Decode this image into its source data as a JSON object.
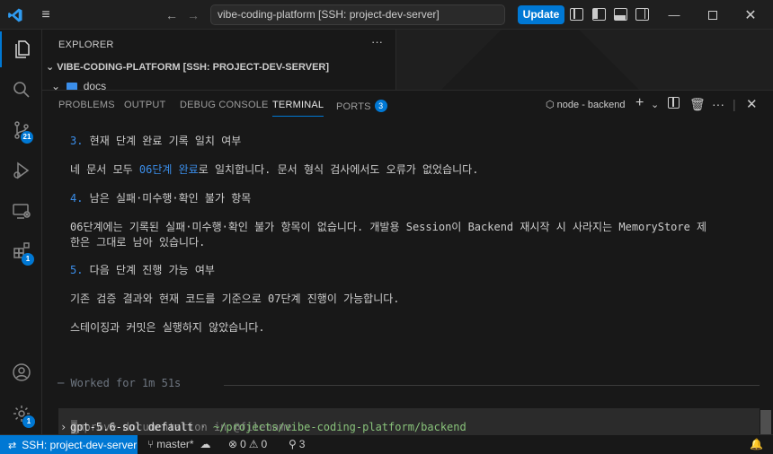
{
  "titlebar": {
    "command_center": "vibe-coding-platform [SSH: project-dev-server]",
    "update_label": "Update"
  },
  "activity": {
    "source_control_badge": "21",
    "extensions_badge": "1",
    "settings_badge": "1"
  },
  "sidebar": {
    "title": "EXPLORER",
    "workspace": "VIBE-CODING-PLATFORM [SSH: PROJECT-DEV-SERVER]",
    "folder": "docs"
  },
  "panel": {
    "tabs": [
      "PROBLEMS",
      "OUTPUT",
      "DEBUG CONSOLE",
      "TERMINAL",
      "PORTS"
    ],
    "active_tab": "TERMINAL",
    "ports_badge": "3",
    "terminal_name": "node - backend"
  },
  "terminal": {
    "lines": [
      {
        "num": "3.",
        "text": " 현재 단계 완료 기록 일치 여부"
      },
      {
        "pre": "네 문서 모두 ",
        "hl": "06단계 완료",
        "post": "로 일치합니다. 문서 형식 검사에서도 오류가 없었습니다."
      },
      {
        "num": "4.",
        "text": " 남은 실패·미수행·확인 불가 항목"
      },
      {
        "text": "06단계에는 기록된 실패·미수행·확인 불가 항목이 없습니다. 개발용 Session이 Backend 재시작 시 사라지는 MemoryStore 제"
      },
      {
        "text": "한은 그대로 남아 있습니다."
      },
      {
        "num": "5.",
        "text": " 다음 단계 진행 가능 여부"
      },
      {
        "text": "기존 검증 결과와 현재 코드를 기준으로 07단계 진행이 가능합니다."
      },
      {
        "text": "스테이징과 커밋은 실행하지 않았습니다."
      }
    ],
    "worked": "─ Worked for 1m 51s",
    "input_placeholder": "Improve documentation in @filename",
    "model": "gpt-5.6-sol default",
    "separator": " · ",
    "cwd": "~/projects/vibe-coding-platform/backend"
  },
  "statusbar": {
    "remote": "SSH: project-dev-server",
    "branch": "master*",
    "errors": "0",
    "warnings": "0",
    "ports": "3"
  }
}
